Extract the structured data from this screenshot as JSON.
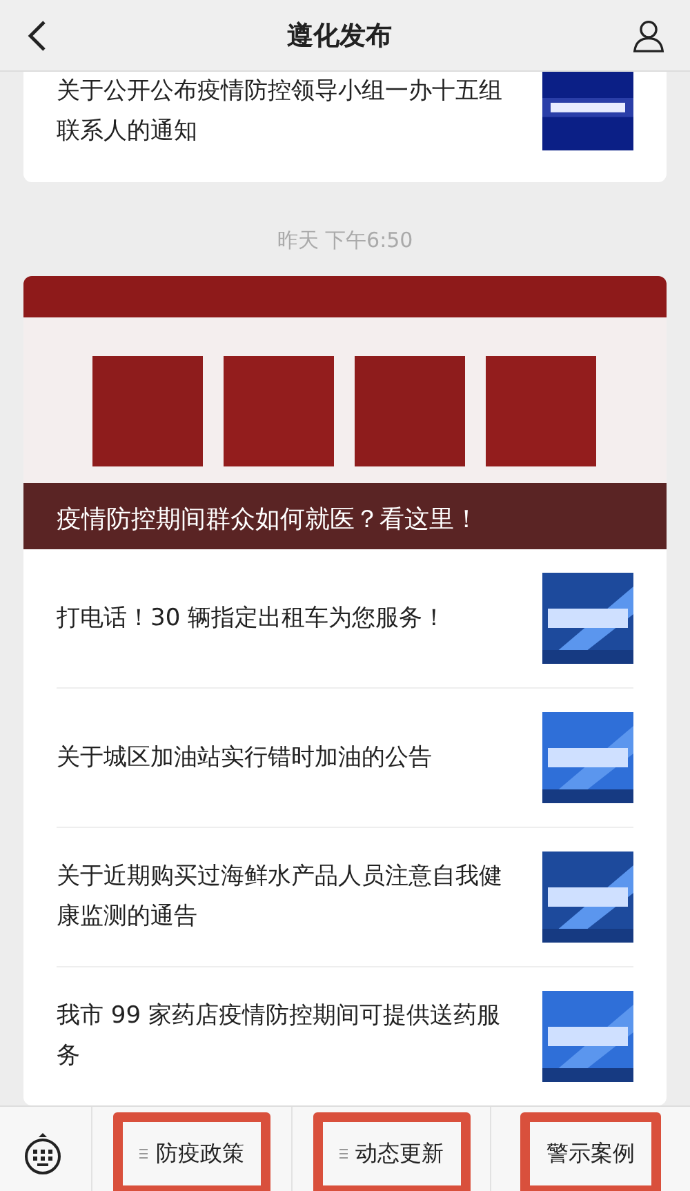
{
  "header": {
    "title": "遵化发布"
  },
  "top_card": {
    "title": "关于公开公布疫情防控领导小组一办十五组联系人的通知"
  },
  "timestamp": "昨天 下午6:50",
  "feed": {
    "banner": {
      "kind": "picture",
      "caption": "疫情防控期间群众如何就医？看这里！"
    },
    "items": [
      {
        "title": "打电话！30 辆指定出租车为您服务！"
      },
      {
        "title": "关于城区加油站实行错时加油的公告"
      },
      {
        "title": "关于近期购买过海鲜水产品人员注意自我健康监测的通告"
      },
      {
        "title": "我市 99 家药店疫情防控期间可提供送药服务"
      }
    ]
  },
  "menu": [
    {
      "label": "防疫政策",
      "kind": "submenu",
      "highlighted": true
    },
    {
      "label": "动态更新",
      "kind": "submenu",
      "highlighted": true
    },
    {
      "label": "警示案例",
      "kind": "plain",
      "highlighted": true
    }
  ]
}
